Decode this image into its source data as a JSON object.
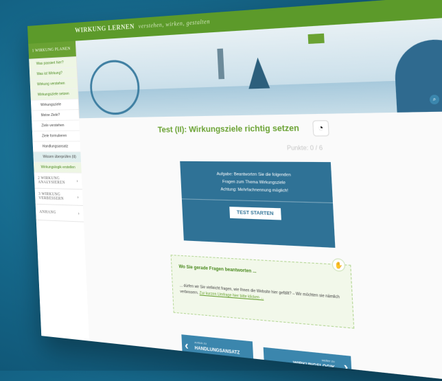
{
  "header": {
    "brand_bold": "WIRKUNG LERNEN",
    "brand_tag": "verstehen, wirken, gestalten",
    "icons": [
      "search-icon",
      "help-icon"
    ]
  },
  "sidebar": {
    "section1": "1 WIRKUNG PLANEN",
    "items": [
      "Was passiert hier?",
      "Was ist Wirkung?",
      "Wirkung verstehen",
      "Wirkungsziele setzen",
      "Wirkungsziele",
      "Meine Ziele?",
      "Ziele verstehen",
      "Ziele formulieren",
      "Handlungsansatz",
      "Wissen überprüfen (II)",
      "Wirkungslogik erstellen"
    ],
    "section2": "2 WIRKUNG ANALYSIEREN",
    "section3": "3 WIRKUNG VERBESSERN",
    "section4": "ANHANG"
  },
  "main": {
    "title": "Test (II): Wirkungsziele richtig setzen",
    "points": "Punkte: 0 / 6",
    "task_line1": "Aufgabe: Beantworten Sie die folgenden",
    "task_line2": "Fragen zum Thema Wirkungsziele",
    "task_line3": "Achtung: Mehrfachnennung möglich!",
    "start_button": "TEST STARTEN",
    "hint_title": "Wo Sie gerade Fragen beantworten ...",
    "hint_text": "... dürfen wir Sie vielleicht fragen, wie Ihnen die Website hier gefällt? – Wir möchten sie nämlich verbessern.",
    "hint_link": "Zur kurzen Umfrage hier bitte klicken ...",
    "prev_small": "zurück zu",
    "prev_label": "HANDLUNGSANSATZ",
    "next_small": "weiter zu",
    "next_label": "WIRKUNGSLOGIK"
  }
}
